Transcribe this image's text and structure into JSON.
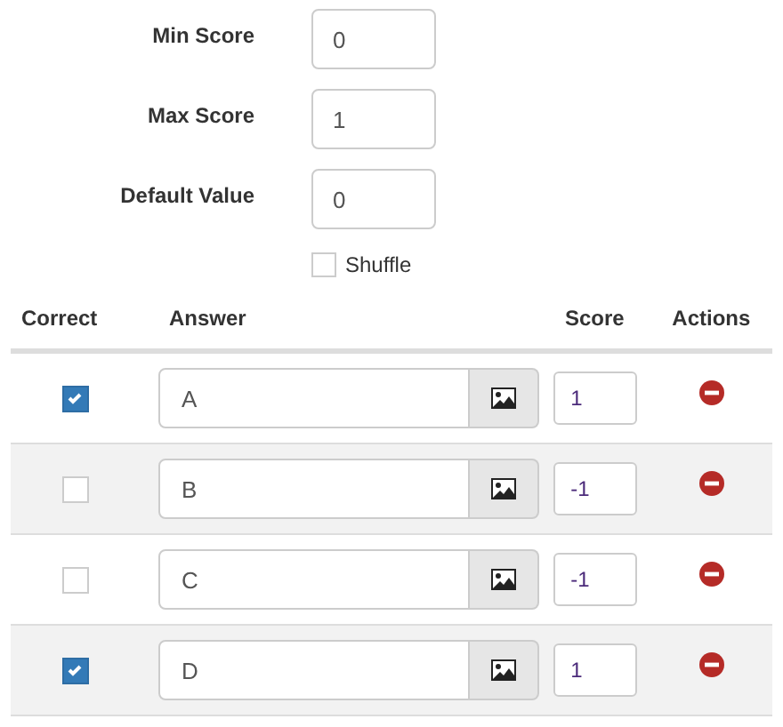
{
  "settings": [
    {
      "label": "Min Score",
      "value": "0"
    },
    {
      "label": "Max Score",
      "value": "1"
    },
    {
      "label": "Default Value",
      "value": "0"
    }
  ],
  "shuffle": {
    "label": "Shuffle",
    "checked": false
  },
  "table": {
    "columns": [
      "Correct",
      "Answer",
      "Score",
      "Actions"
    ],
    "rows": [
      {
        "correct": true,
        "answer": "A",
        "score": "1"
      },
      {
        "correct": false,
        "answer": "B",
        "score": "-1"
      },
      {
        "correct": false,
        "answer": "C",
        "score": "-1"
      },
      {
        "correct": true,
        "answer": "D",
        "score": "1"
      }
    ]
  }
}
